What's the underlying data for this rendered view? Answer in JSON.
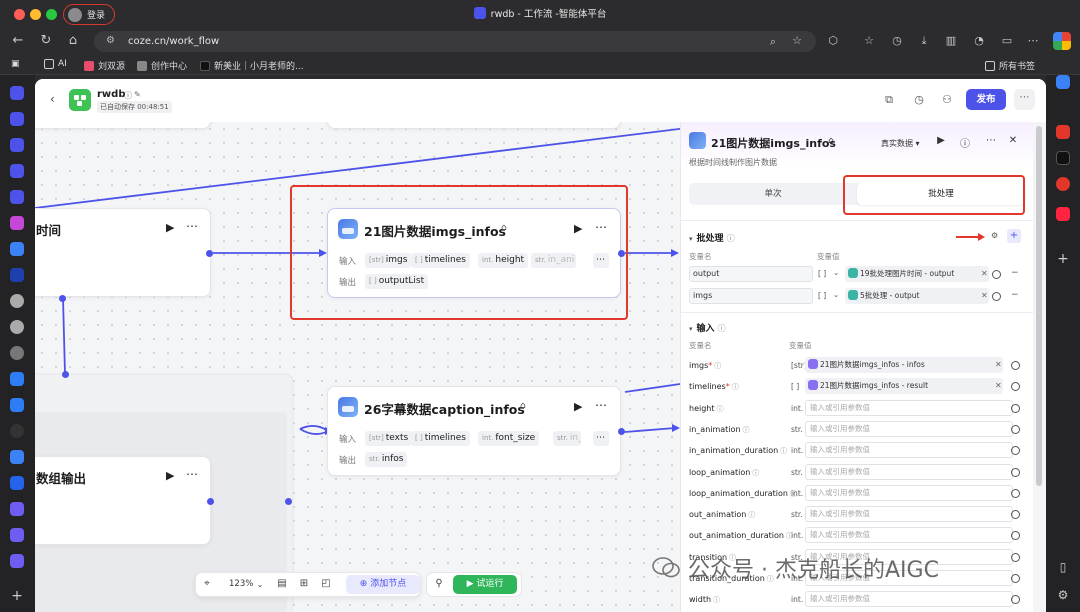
{
  "browser": {
    "login_label": "登录",
    "tab_title": "rwdb - 工作流 -智能体平台",
    "url": "coze.cn/work_flow",
    "bookmarks": [
      "AI",
      "刘双源",
      "创作中心",
      "新美业｜小月老师的...",
      "所有书签"
    ]
  },
  "app": {
    "name": "rwdb",
    "autosave": "已自动保存 00:48:51",
    "publish_label": "发布"
  },
  "canvas": {
    "node_left_top": {
      "title": "时间"
    },
    "node_left_bottom": {
      "title": "数组输出"
    },
    "node_imgs": {
      "title": "21图片数据imgs_infos",
      "input_label": "输入",
      "output_label": "输出",
      "inputs": [
        {
          "type": "[str]",
          "name": "imgs"
        },
        {
          "type": "[ ]",
          "name": "timelines"
        },
        {
          "type": "int.",
          "name": "height"
        },
        {
          "type": "str.",
          "name": "in_ani"
        }
      ],
      "outputs": [
        {
          "type": "[ ]",
          "name": "outputList"
        }
      ]
    },
    "node_caption": {
      "title": "26字幕数据caption_infos",
      "input_label": "输入",
      "output_label": "输出",
      "inputs": [
        {
          "type": "[str]",
          "name": "texts"
        },
        {
          "type": "[ ]",
          "name": "timelines"
        },
        {
          "type": "int.",
          "name": "font_size"
        },
        {
          "type": "str.",
          "name": "in_"
        }
      ],
      "outputs": [
        {
          "type": "str.",
          "name": "infos"
        }
      ]
    },
    "toolbar": {
      "zoom": "123%",
      "add_node": "添加节点",
      "run": "试运行"
    }
  },
  "panel": {
    "title": "21图片数据imgs_infos",
    "description": "根据时间线制作图片数据",
    "real_data": "真实数据",
    "tabs": [
      {
        "label": "单次"
      },
      {
        "label": "批处理"
      }
    ],
    "batch": {
      "section_title": "批处理",
      "col_name": "变量名",
      "col_value": "变量值",
      "rows": [
        {
          "name": "output",
          "type": "[ ]",
          "ref": "19批处理图片时间 - output"
        },
        {
          "name": "imgs",
          "type": "[ ]",
          "ref": "5批处理 - output"
        }
      ]
    },
    "inputs": {
      "section_title": "输入",
      "col_name": "变量名",
      "col_value": "变量值",
      "placeholder": "输入或引用参数值",
      "rows": [
        {
          "name": "imgs",
          "required": true,
          "type": "[str]",
          "ref": "21图片数据imgs_infos - infos"
        },
        {
          "name": "timelines",
          "required": true,
          "type": "[ ]",
          "ref": "21图片数据imgs_infos - result"
        },
        {
          "name": "height",
          "required": false,
          "type": "int."
        },
        {
          "name": "in_animation",
          "required": false,
          "type": "str."
        },
        {
          "name": "in_animation_duration",
          "required": false,
          "type": "int."
        },
        {
          "name": "loop_animation",
          "required": false,
          "type": "str."
        },
        {
          "name": "loop_animation_duration",
          "required": false,
          "type": "int."
        },
        {
          "name": "out_animation",
          "required": false,
          "type": "str."
        },
        {
          "name": "out_animation_duration",
          "required": false,
          "type": "int."
        },
        {
          "name": "transition",
          "required": false,
          "type": "str."
        },
        {
          "name": "transition_duration",
          "required": false,
          "type": "int."
        },
        {
          "name": "width",
          "required": false,
          "type": "int."
        }
      ]
    }
  },
  "watermark": "公众号 · 杰克船长的AIGC",
  "colors": {
    "accent": "#4d53e8",
    "run_green": "#2fb55a",
    "annotation_red": "#e2382b"
  }
}
